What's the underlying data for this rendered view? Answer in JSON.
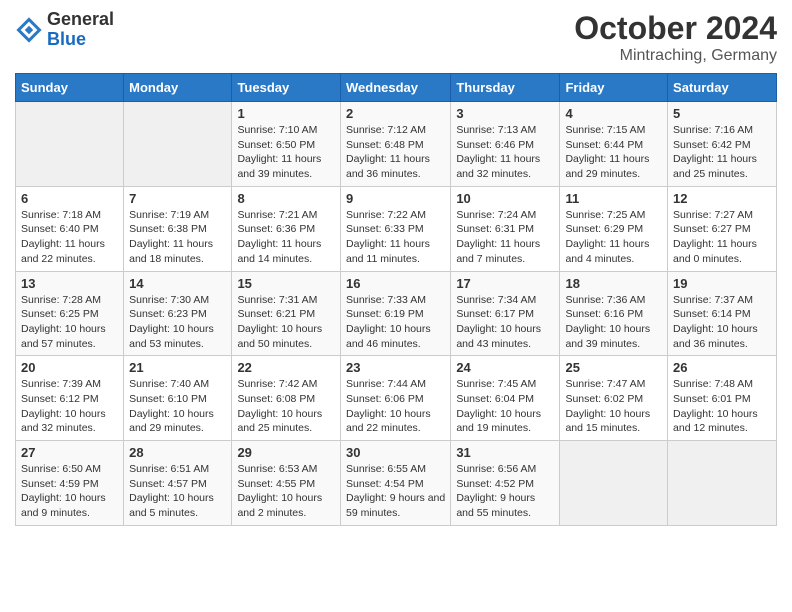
{
  "header": {
    "logo": {
      "general": "General",
      "blue": "Blue"
    },
    "title": "October 2024",
    "subtitle": "Mintraching, Germany"
  },
  "calendar": {
    "weekdays": [
      "Sunday",
      "Monday",
      "Tuesday",
      "Wednesday",
      "Thursday",
      "Friday",
      "Saturday"
    ],
    "weeks": [
      [
        {
          "day": "",
          "info": ""
        },
        {
          "day": "",
          "info": ""
        },
        {
          "day": "1",
          "info": "Sunrise: 7:10 AM\nSunset: 6:50 PM\nDaylight: 11 hours and 39 minutes."
        },
        {
          "day": "2",
          "info": "Sunrise: 7:12 AM\nSunset: 6:48 PM\nDaylight: 11 hours and 36 minutes."
        },
        {
          "day": "3",
          "info": "Sunrise: 7:13 AM\nSunset: 6:46 PM\nDaylight: 11 hours and 32 minutes."
        },
        {
          "day": "4",
          "info": "Sunrise: 7:15 AM\nSunset: 6:44 PM\nDaylight: 11 hours and 29 minutes."
        },
        {
          "day": "5",
          "info": "Sunrise: 7:16 AM\nSunset: 6:42 PM\nDaylight: 11 hours and 25 minutes."
        }
      ],
      [
        {
          "day": "6",
          "info": "Sunrise: 7:18 AM\nSunset: 6:40 PM\nDaylight: 11 hours and 22 minutes."
        },
        {
          "day": "7",
          "info": "Sunrise: 7:19 AM\nSunset: 6:38 PM\nDaylight: 11 hours and 18 minutes."
        },
        {
          "day": "8",
          "info": "Sunrise: 7:21 AM\nSunset: 6:36 PM\nDaylight: 11 hours and 14 minutes."
        },
        {
          "day": "9",
          "info": "Sunrise: 7:22 AM\nSunset: 6:33 PM\nDaylight: 11 hours and 11 minutes."
        },
        {
          "day": "10",
          "info": "Sunrise: 7:24 AM\nSunset: 6:31 PM\nDaylight: 11 hours and 7 minutes."
        },
        {
          "day": "11",
          "info": "Sunrise: 7:25 AM\nSunset: 6:29 PM\nDaylight: 11 hours and 4 minutes."
        },
        {
          "day": "12",
          "info": "Sunrise: 7:27 AM\nSunset: 6:27 PM\nDaylight: 11 hours and 0 minutes."
        }
      ],
      [
        {
          "day": "13",
          "info": "Sunrise: 7:28 AM\nSunset: 6:25 PM\nDaylight: 10 hours and 57 minutes."
        },
        {
          "day": "14",
          "info": "Sunrise: 7:30 AM\nSunset: 6:23 PM\nDaylight: 10 hours and 53 minutes."
        },
        {
          "day": "15",
          "info": "Sunrise: 7:31 AM\nSunset: 6:21 PM\nDaylight: 10 hours and 50 minutes."
        },
        {
          "day": "16",
          "info": "Sunrise: 7:33 AM\nSunset: 6:19 PM\nDaylight: 10 hours and 46 minutes."
        },
        {
          "day": "17",
          "info": "Sunrise: 7:34 AM\nSunset: 6:17 PM\nDaylight: 10 hours and 43 minutes."
        },
        {
          "day": "18",
          "info": "Sunrise: 7:36 AM\nSunset: 6:16 PM\nDaylight: 10 hours and 39 minutes."
        },
        {
          "day": "19",
          "info": "Sunrise: 7:37 AM\nSunset: 6:14 PM\nDaylight: 10 hours and 36 minutes."
        }
      ],
      [
        {
          "day": "20",
          "info": "Sunrise: 7:39 AM\nSunset: 6:12 PM\nDaylight: 10 hours and 32 minutes."
        },
        {
          "day": "21",
          "info": "Sunrise: 7:40 AM\nSunset: 6:10 PM\nDaylight: 10 hours and 29 minutes."
        },
        {
          "day": "22",
          "info": "Sunrise: 7:42 AM\nSunset: 6:08 PM\nDaylight: 10 hours and 25 minutes."
        },
        {
          "day": "23",
          "info": "Sunrise: 7:44 AM\nSunset: 6:06 PM\nDaylight: 10 hours and 22 minutes."
        },
        {
          "day": "24",
          "info": "Sunrise: 7:45 AM\nSunset: 6:04 PM\nDaylight: 10 hours and 19 minutes."
        },
        {
          "day": "25",
          "info": "Sunrise: 7:47 AM\nSunset: 6:02 PM\nDaylight: 10 hours and 15 minutes."
        },
        {
          "day": "26",
          "info": "Sunrise: 7:48 AM\nSunset: 6:01 PM\nDaylight: 10 hours and 12 minutes."
        }
      ],
      [
        {
          "day": "27",
          "info": "Sunrise: 6:50 AM\nSunset: 4:59 PM\nDaylight: 10 hours and 9 minutes."
        },
        {
          "day": "28",
          "info": "Sunrise: 6:51 AM\nSunset: 4:57 PM\nDaylight: 10 hours and 5 minutes."
        },
        {
          "day": "29",
          "info": "Sunrise: 6:53 AM\nSunset: 4:55 PM\nDaylight: 10 hours and 2 minutes."
        },
        {
          "day": "30",
          "info": "Sunrise: 6:55 AM\nSunset: 4:54 PM\nDaylight: 9 hours and 59 minutes."
        },
        {
          "day": "31",
          "info": "Sunrise: 6:56 AM\nSunset: 4:52 PM\nDaylight: 9 hours and 55 minutes."
        },
        {
          "day": "",
          "info": ""
        },
        {
          "day": "",
          "info": ""
        }
      ]
    ]
  }
}
